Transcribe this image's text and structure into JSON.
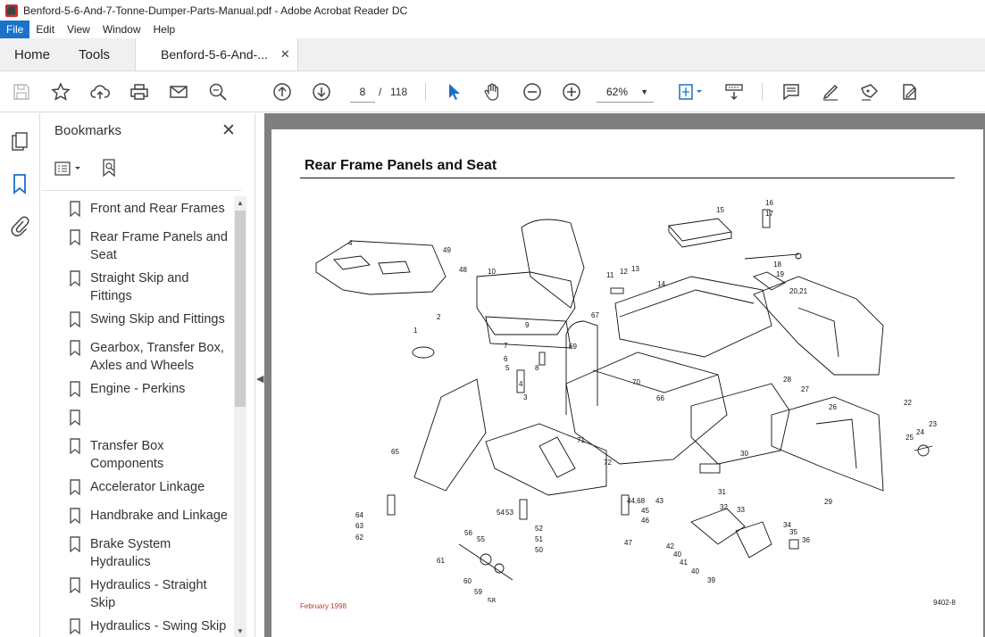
{
  "window": {
    "title": "Benford-5-6-And-7-Tonne-Dumper-Parts-Manual.pdf - Adobe Acrobat Reader DC"
  },
  "menu": [
    "File",
    "Edit",
    "View",
    "Window",
    "Help"
  ],
  "tabs": {
    "home": "Home",
    "tools": "Tools",
    "doc": "Benford-5-6-And-..."
  },
  "toolbar": {
    "page_current": "8",
    "page_separator": "/",
    "page_total": "118",
    "zoom": "62%"
  },
  "bookmarks": {
    "title": "Bookmarks",
    "items": [
      "Front and Rear Frames",
      "Rear Frame Panels and Seat",
      "Straight Skip and Fittings",
      "Swing Skip and Fittings",
      "Gearbox, Transfer Box, Axles and Wheels",
      "Engine - Perkins",
      "",
      "Transfer Box Components",
      "Accelerator Linkage",
      "Handbrake and Linkage",
      "Brake System Hydraulics",
      "Hydraulics - Straight Skip",
      "Hydraulics - Swing Skip"
    ]
  },
  "page": {
    "title": "Rear Frame Panels and Seat",
    "footer_date": "February 1998",
    "footer_code": "9402-8"
  },
  "callouts": [
    "1",
    "2",
    "3",
    "4",
    "4",
    "5",
    "6",
    "7",
    "8",
    "9",
    "10",
    "11",
    "12",
    "13",
    "14",
    "15",
    "16",
    "17",
    "18",
    "19",
    "20,21",
    "22",
    "23",
    "24",
    "25",
    "26",
    "27",
    "28",
    "29",
    "30",
    "31",
    "32",
    "33",
    "34",
    "35",
    "36",
    "39",
    "40",
    "40",
    "41",
    "42",
    "43",
    "44,68",
    "45",
    "46",
    "47",
    "48",
    "49",
    "50",
    "51",
    "52",
    "53",
    "54",
    "55",
    "56",
    "58",
    "59",
    "60",
    "61",
    "62",
    "63",
    "64",
    "65",
    "66",
    "67",
    "69",
    "70",
    "71",
    "72"
  ]
}
